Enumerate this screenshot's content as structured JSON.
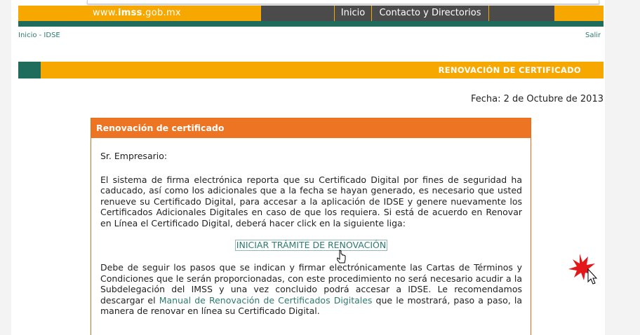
{
  "header": {
    "url_prefix": "www.",
    "url_domain": "imss",
    "url_suffix": ".gob.mx",
    "nav": [
      {
        "label": "Inicio"
      },
      {
        "label": "Contacto y Directorios"
      }
    ]
  },
  "breadcrumb": {
    "text": "Inicio - IDSE",
    "salir": "Salir"
  },
  "section": {
    "title": "RENOVACIÓN DE CERTIFICADO"
  },
  "fecha": "Fecha: 2 de Octubre de 2013",
  "box": {
    "title": "Renovación de certificado",
    "greeting": "Sr. Empresario:",
    "para1": "El sistema de firma electrónica reporta que su Certificado Digital por fines de seguridad ha caducado, así como los adicionales que a la fecha se hayan generado, es necesario que usted renueve su Certificado Digital, para accesar a la aplicación de IDSE y genere nuevamente los Certificados Adicionales Digitales en caso de que los requiera. Si está de acuerdo en Renovar en Línea el Certificado Digital, deberá hacer click en la siguiente liga:",
    "link": "INICIAR TRÁMITE DE RENOVACIÓN",
    "para2_a": "Debe de seguir los pasos que se indican y firmar electrónicamente las Cartas de Términos y Condiciones que le serán proporcionadas, con este procedimiento no será necesario acudir a la Subdelegación del IMSS y una vez concluido podrá accesar a IDSE. Le recomendamos descargar el ",
    "para2_link": "Manual de Renovación de Certificados Digitales",
    "para2_b": " que le mostrará, paso a paso, la manera de renovar en línea su Certificado Digital."
  },
  "colors": {
    "orange": "#f7a800",
    "green": "#1f6b5c",
    "box_orange": "#ec7422",
    "link": "#2d7a6f"
  },
  "icons": [
    "mouse-cursor-icon",
    "click-starburst-icon"
  ]
}
